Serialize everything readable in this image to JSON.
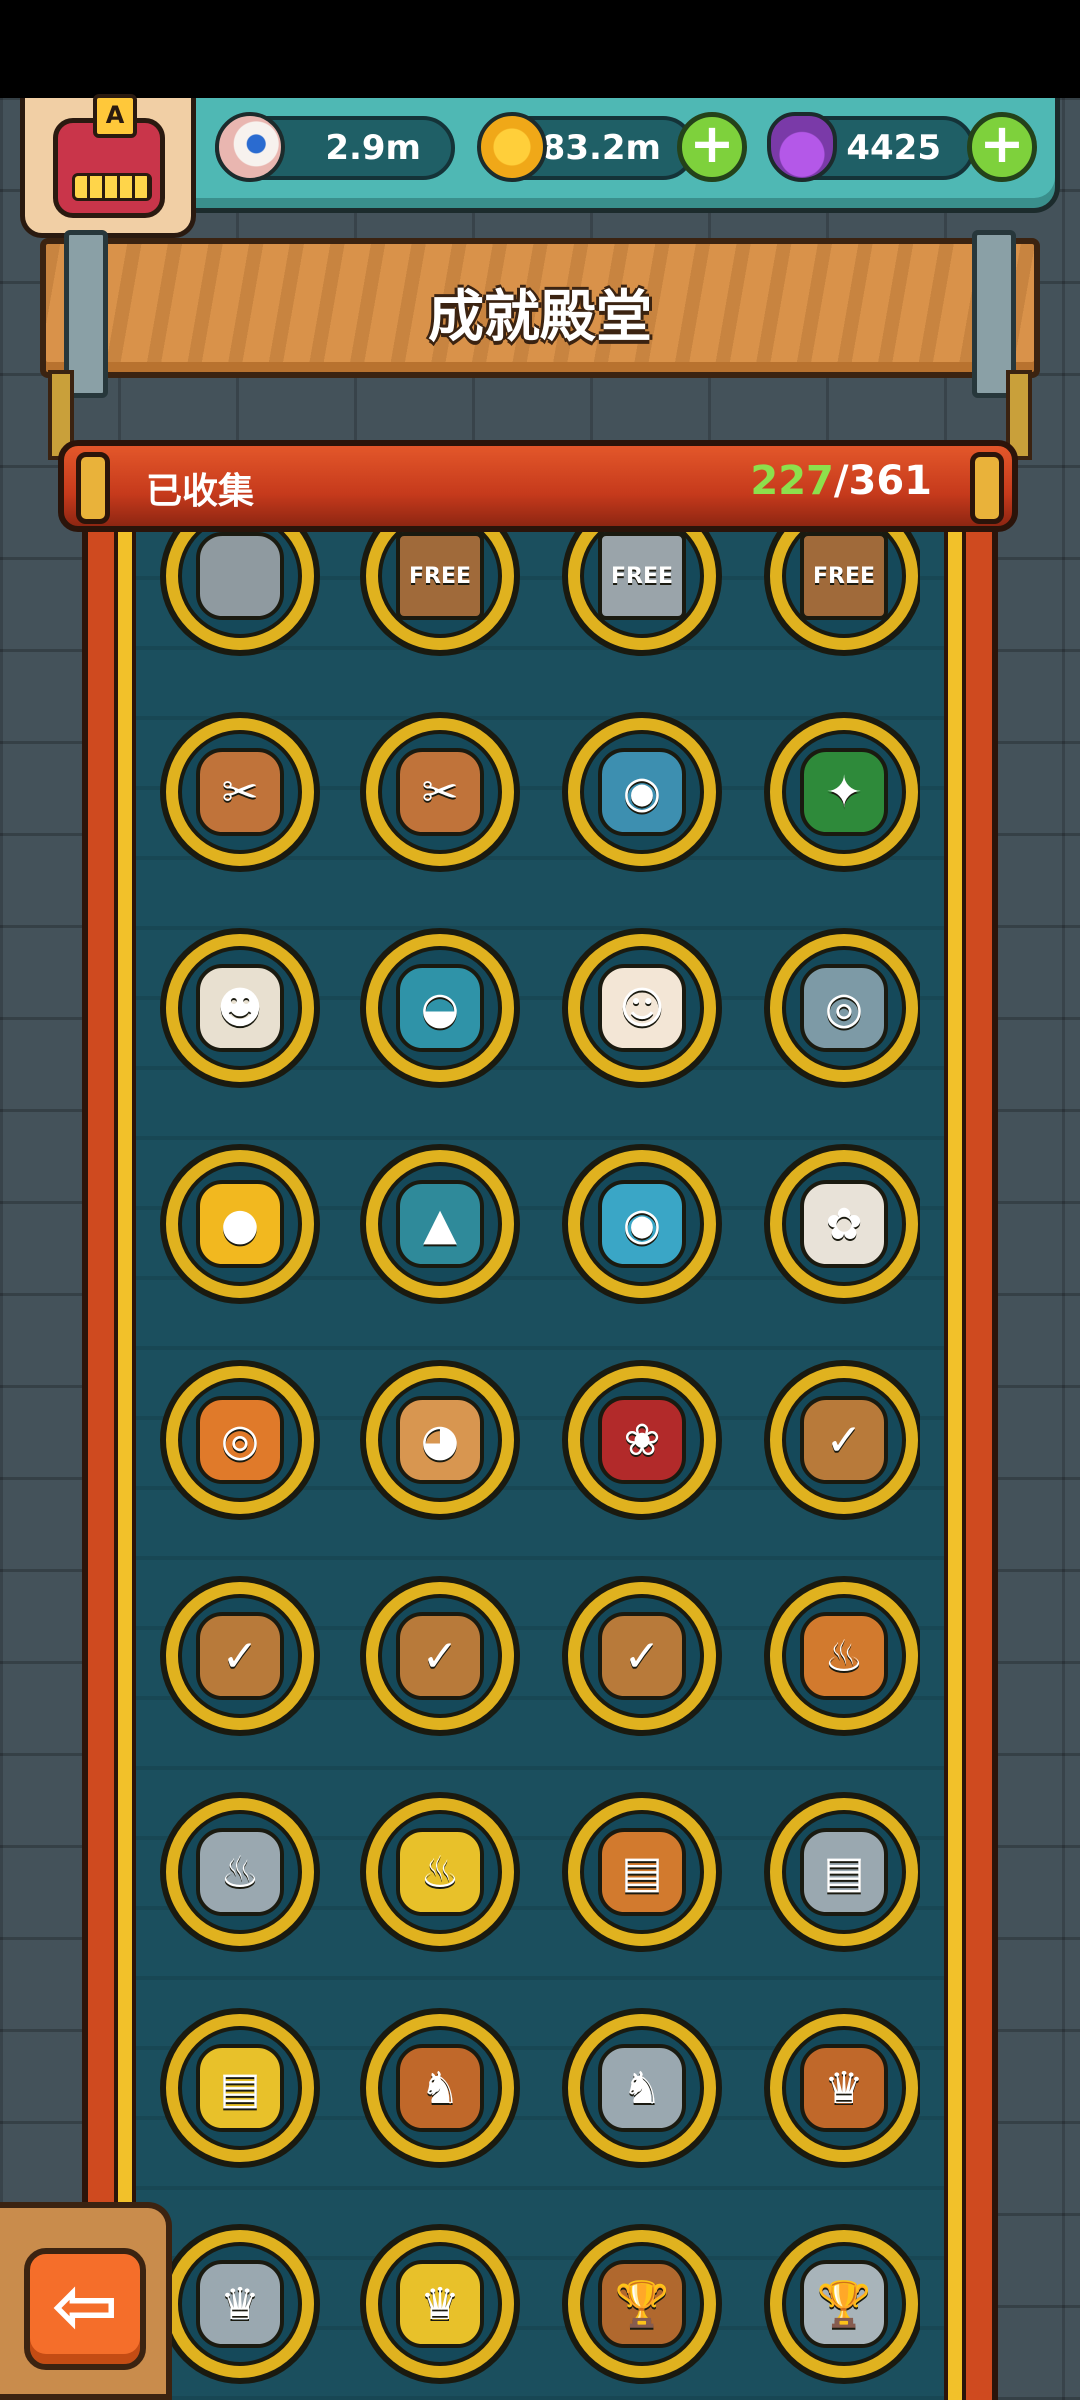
{
  "header": {
    "resources": [
      {
        "name": "eyeball",
        "icon": "eyeball-icon",
        "value": "2.9m",
        "has_plus": false
      },
      {
        "name": "coin",
        "icon": "coin-icon",
        "value": "83.2m",
        "has_plus": true
      },
      {
        "name": "potion",
        "icon": "potion-icon",
        "value": "4425",
        "has_plus": true
      }
    ],
    "avatar_badge": "A"
  },
  "title": "成就殿堂",
  "progress": {
    "label": "已收集",
    "collected": "227",
    "separator": "/",
    "total": "361"
  },
  "achievements": [
    {
      "icon": "galaxy-oven-icon",
      "color": "#8f9aa0",
      "glyph": ""
    },
    {
      "icon": "free-sign-bronze-icon",
      "color": "#a06a3a",
      "glyph": "FREE"
    },
    {
      "icon": "free-sign-silver-icon",
      "color": "#9aa4aa",
      "glyph": "FREE"
    },
    {
      "icon": "free-sign-bronze-icon",
      "color": "#a06a3a",
      "glyph": "FREE"
    },
    {
      "icon": "crossed-tools-bronze-icon",
      "color": "#c0733a",
      "glyph": "✂"
    },
    {
      "icon": "crossed-tools-bronze-icon",
      "color": "#c0733a",
      "glyph": "✂"
    },
    {
      "icon": "eyeball-cluster-icon",
      "color": "#3d8fb0",
      "glyph": "◉"
    },
    {
      "icon": "christmas-tree-icon",
      "color": "#2e8a3a",
      "glyph": "✦"
    },
    {
      "icon": "lion-dance-icon",
      "color": "#e8e0d0",
      "glyph": "☻"
    },
    {
      "icon": "steamer-dome-icon",
      "color": "#2f93a8",
      "glyph": "◒"
    },
    {
      "icon": "clown-icon",
      "color": "#f3e6d6",
      "glyph": "☺"
    },
    {
      "icon": "robot-explorer-icon",
      "color": "#7d9aa6",
      "glyph": "◎"
    },
    {
      "icon": "chicken-icon",
      "color": "#f2b81f",
      "glyph": "●"
    },
    {
      "icon": "dragon-icon",
      "color": "#2f8a9a",
      "glyph": "▲"
    },
    {
      "icon": "cyclops-monster-icon",
      "color": "#3aa6c6",
      "glyph": "◉"
    },
    {
      "icon": "rabbit-icon",
      "color": "#e8e2d8",
      "glyph": "✿"
    },
    {
      "icon": "pumpkin-robot-icon",
      "color": "#e07a2a",
      "glyph": "◎"
    },
    {
      "icon": "crying-dog-icon",
      "color": "#d89650",
      "glyph": "◕"
    },
    {
      "icon": "rose-icon",
      "color": "#b22a2a",
      "glyph": "❀"
    },
    {
      "icon": "scroll-check-icon",
      "color": "#b87a3a",
      "glyph": "✓"
    },
    {
      "icon": "scroll-stack-check-icon",
      "color": "#b87a3a",
      "glyph": "✓"
    },
    {
      "icon": "scroll-stack-check-icon",
      "color": "#b87a3a",
      "glyph": "✓"
    },
    {
      "icon": "scroll-stack-check-icon",
      "color": "#b87a3a",
      "glyph": "✓"
    },
    {
      "icon": "chef-bronze-icon",
      "color": "#d27a2e",
      "glyph": "♨"
    },
    {
      "icon": "chef-silver-icon",
      "color": "#9aa8b0",
      "glyph": "♨"
    },
    {
      "icon": "chef-gold-icon",
      "color": "#e8c12a",
      "glyph": "♨"
    },
    {
      "icon": "bread-bronze-icon",
      "color": "#d27a2e",
      "glyph": "▤"
    },
    {
      "icon": "bread-silver-icon",
      "color": "#9aa8b0",
      "glyph": "▤"
    },
    {
      "icon": "bread-gold-icon",
      "color": "#e8c12a",
      "glyph": "▤"
    },
    {
      "icon": "ogre-bronze-icon",
      "color": "#c0682a",
      "glyph": "♞"
    },
    {
      "icon": "ogre-silver-icon",
      "color": "#9aa8b0",
      "glyph": "♞"
    },
    {
      "icon": "tiger-bronze-icon",
      "color": "#c0682a",
      "glyph": "♛"
    },
    {
      "icon": "tiger-silver-icon",
      "color": "#9aa8b0",
      "glyph": "♛"
    },
    {
      "icon": "tiger-gold-icon",
      "color": "#e8c12a",
      "glyph": "♛"
    },
    {
      "icon": "trophy-bronze-icon",
      "color": "#b0682e",
      "glyph": "🏆"
    },
    {
      "icon": "trophy-silver-icon",
      "color": "#a8b4ba",
      "glyph": "🏆"
    }
  ]
}
